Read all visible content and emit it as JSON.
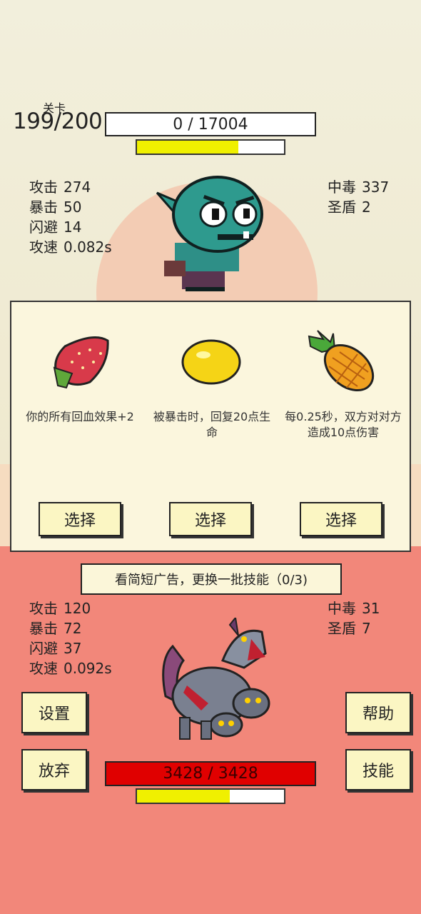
{
  "level": {
    "label": "关卡",
    "value": "199/200"
  },
  "enemy": {
    "hp_text": "0 / 17004",
    "energy": 0.69,
    "stats": [
      {
        "label": "攻击",
        "value": "274"
      },
      {
        "label": "暴击",
        "value": "50"
      },
      {
        "label": "闪避",
        "value": "14"
      },
      {
        "label": "攻速",
        "value": "0.082s"
      }
    ],
    "status": [
      {
        "label": "中毒",
        "value": "337"
      },
      {
        "label": "圣盾",
        "value": "2"
      }
    ]
  },
  "skill_choices": [
    {
      "icon": "strawberry-icon",
      "desc": "你的所有回血效果+2",
      "button": "选择"
    },
    {
      "icon": "lemon-icon",
      "desc": "被暴击时，回复20点生命",
      "button": "选择"
    },
    {
      "icon": "pineapple-icon",
      "desc": "每0.25秒，双方对对方造成10点伤害",
      "button": "选择"
    }
  ],
  "ad_banner": "看简短广告，更换一批技能（0/3)",
  "player": {
    "hp_text": "3428 / 3428",
    "energy": 0.63,
    "stats": [
      {
        "label": "攻击",
        "value": "120"
      },
      {
        "label": "暴击",
        "value": "72"
      },
      {
        "label": "闪避",
        "value": "37"
      },
      {
        "label": "攻速",
        "value": "0.092s"
      }
    ],
    "status": [
      {
        "label": "中毒",
        "value": "31"
      },
      {
        "label": "圣盾",
        "value": "7"
      }
    ]
  },
  "buttons": {
    "settings": "设置",
    "help": "帮助",
    "give_up": "放弃",
    "skills": "技能"
  },
  "colors": {
    "player_hp": "#e00000",
    "energy": "#f0f000",
    "panel": "#fbf6dd",
    "button": "#fbf6c3"
  }
}
